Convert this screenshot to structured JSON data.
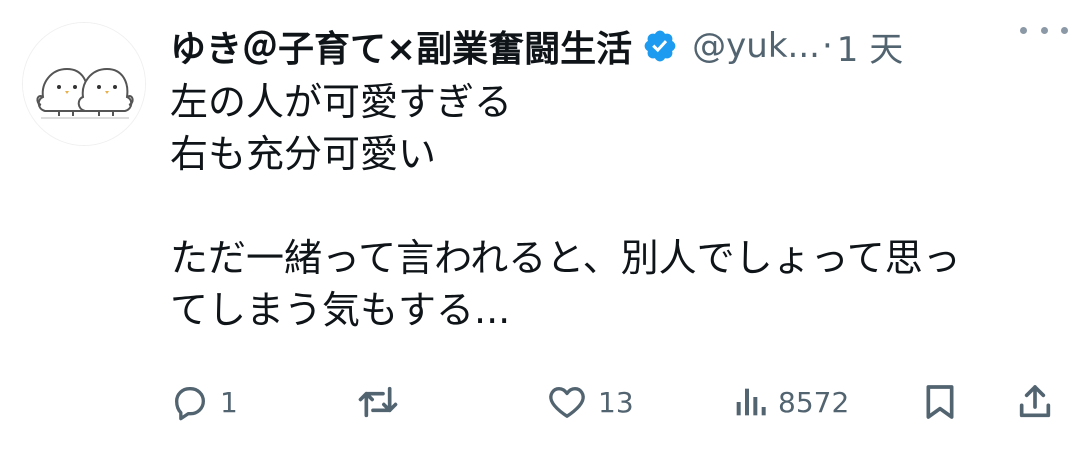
{
  "user": {
    "display_name": "ゆき＠子育て×副業奮闘生活",
    "handle": "@yuk...",
    "separator": "·",
    "time": "1 天"
  },
  "tweet": {
    "lines": [
      "左の人が可愛すぎる",
      "右も充分可愛い",
      "",
      "ただ一緒って言われると、別人でしょって思っ",
      "てしまう気もする..."
    ]
  },
  "actions": {
    "reply_count": "1",
    "retweet_count": "",
    "like_count": "13",
    "views_count": "8572"
  },
  "icons": {
    "verified": "verified-badge-icon",
    "more": "more-icon",
    "reply": "reply-icon",
    "retweet": "retweet-icon",
    "like": "heart-icon",
    "views": "views-icon",
    "bookmark": "bookmark-icon",
    "share": "share-icon"
  },
  "colors": {
    "verified_blue": "#1d9bf0",
    "text_primary": "#0f1419",
    "text_secondary": "#536471"
  }
}
